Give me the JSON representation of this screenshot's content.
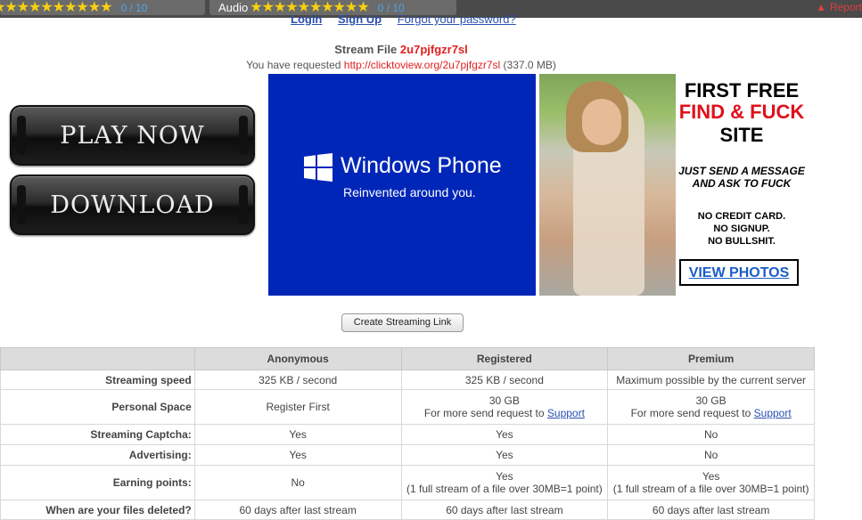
{
  "topbar": {
    "video_score": "0 / 10",
    "audio_label": "Audio",
    "audio_score": "0 / 10",
    "stars": "★★★★★★★★★★",
    "report_label": "Report"
  },
  "auth": {
    "login": "Login",
    "signup": "Sign Up",
    "forgot": "Forgot your password?"
  },
  "stream": {
    "title_prefix": "Stream File",
    "file_id": "2u7pjfgzr7sl",
    "requested_prefix": "You have requested",
    "url": "http://clicktoview.org/2u7pjfgzr7sl",
    "size": "(337.0 MB)"
  },
  "buttons": {
    "play": "PLAY NOW",
    "download": "DOWNLOAD",
    "create_link": "Create Streaming Link"
  },
  "ads": {
    "wp_brand": "Windows Phone",
    "wp_tag": "Reinvented around you.",
    "text_l1": "FIRST FREE",
    "text_l2": "FIND & FUCK",
    "text_l3": "SITE",
    "text_l4a": "JUST SEND A MESSAGE",
    "text_l4b": "AND ASK TO FUCK",
    "text_l5a": "NO CREDIT CARD.",
    "text_l5b": "NO SIGNUP.",
    "text_l5c": "NO BULLSHIT.",
    "cta": "VIEW PHOTOS"
  },
  "table": {
    "headers": [
      "",
      "Anonymous",
      "Registered",
      "Premium"
    ],
    "rows": [
      {
        "label": "Streaming speed",
        "anon": "325 KB / second",
        "reg": "325 KB / second",
        "prem": "Maximum possible by the current server"
      },
      {
        "label": "Personal Space",
        "anon": "Register First",
        "reg": "30 GB",
        "reg_sub": "For more send request to",
        "prem": "30 GB",
        "prem_sub": "For more send request to",
        "link": "Support"
      },
      {
        "label": "Streaming Captcha:",
        "anon": "Yes",
        "reg": "Yes",
        "prem": "No"
      },
      {
        "label": "Advertising:",
        "anon": "Yes",
        "reg": "Yes",
        "prem": "No"
      },
      {
        "label": "Earning points:",
        "anon": "No",
        "reg": "Yes",
        "reg_sub": "(1 full stream of a file over 30MB=1 point)",
        "prem": "Yes",
        "prem_sub": "(1 full stream of a file over 30MB=1 point)"
      },
      {
        "label": "When are your files deleted?",
        "anon": "60 days after last stream",
        "reg": "60 days after last stream",
        "prem": "60 days after last stream"
      }
    ]
  }
}
